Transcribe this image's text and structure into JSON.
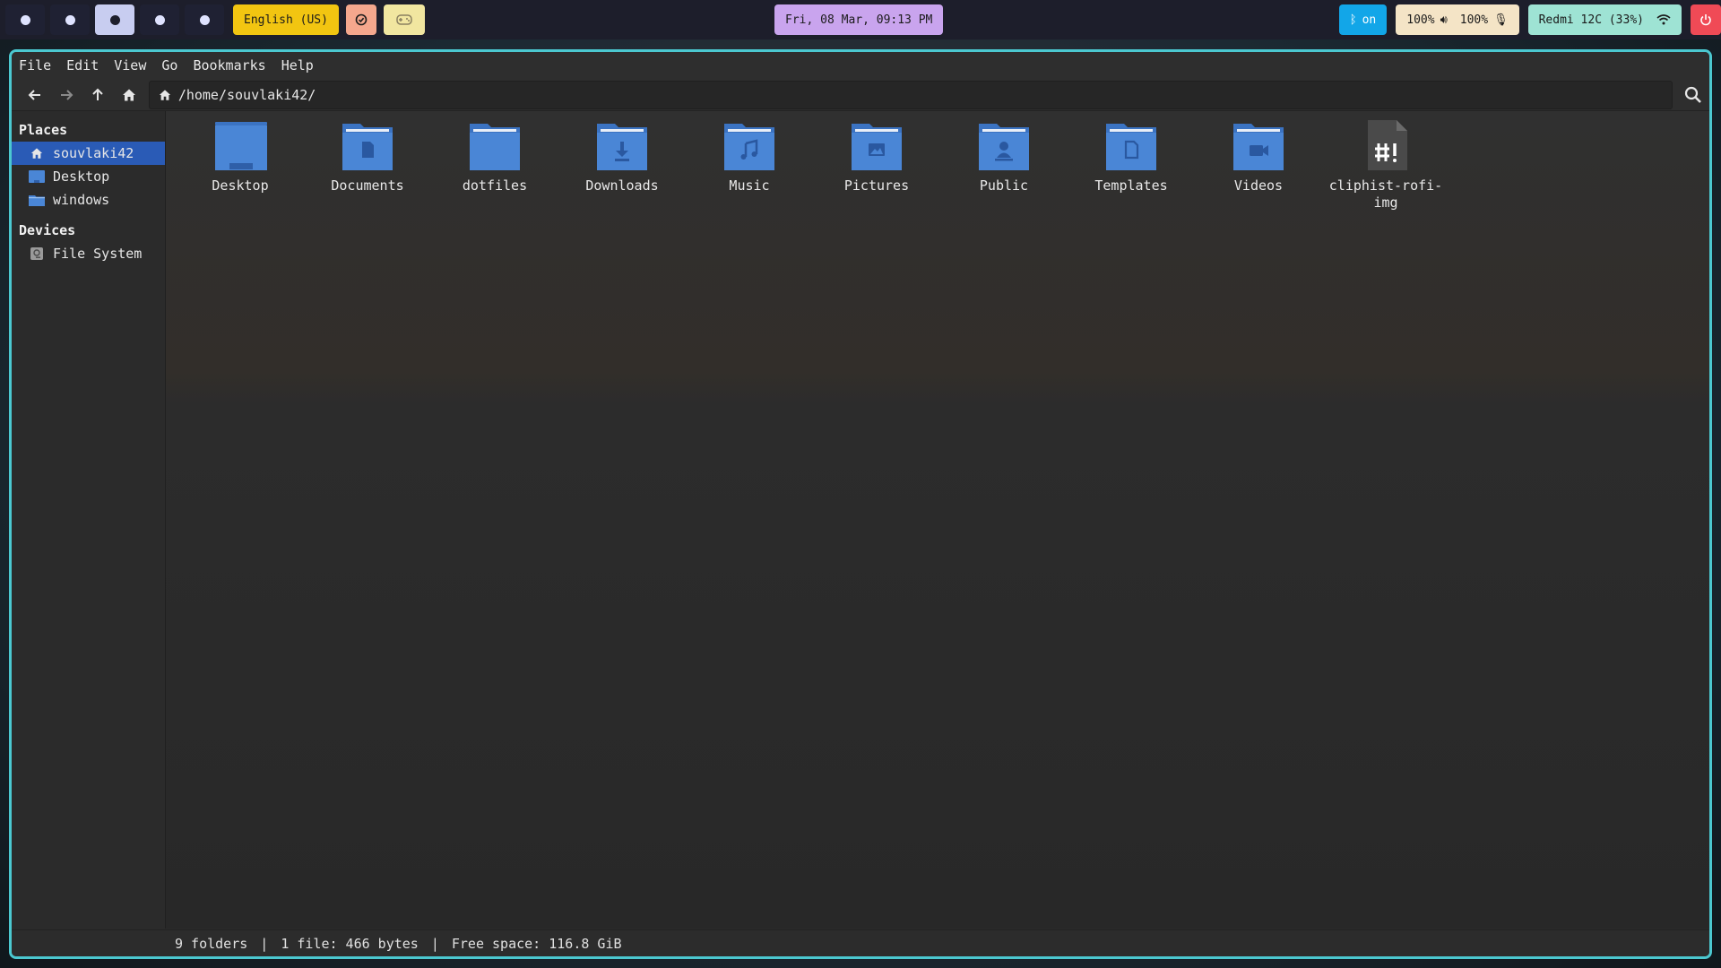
{
  "topbar": {
    "workspaces": [
      "",
      "",
      "",
      "",
      ""
    ],
    "keyboard_layout": "English (US)",
    "clock": "Fri, 08 Mar, 09:13 PM",
    "bluetooth": "on",
    "volume": "100%",
    "mic": "100%",
    "network": "Redmi 12C (33%)"
  },
  "menu": {
    "file": "File",
    "edit": "Edit",
    "view": "View",
    "go": "Go",
    "bookmarks": "Bookmarks",
    "help": "Help"
  },
  "path": "/home/souvlaki42/",
  "sidebar": {
    "places_label": "Places",
    "places": [
      {
        "label": "souvlaki42",
        "icon": "home-icon"
      },
      {
        "label": "Desktop",
        "icon": "desktop-icon"
      },
      {
        "label": "windows",
        "icon": "folder-icon"
      }
    ],
    "devices_label": "Devices",
    "devices": [
      {
        "label": "File System",
        "icon": "drive-icon"
      }
    ]
  },
  "files": [
    {
      "name": "Desktop",
      "icon": "desktop-folder-icon"
    },
    {
      "name": "Documents",
      "icon": "documents-folder-icon"
    },
    {
      "name": "dotfiles",
      "icon": "folder-icon"
    },
    {
      "name": "Downloads",
      "icon": "downloads-folder-icon"
    },
    {
      "name": "Music",
      "icon": "music-folder-icon"
    },
    {
      "name": "Pictures",
      "icon": "pictures-folder-icon"
    },
    {
      "name": "Public",
      "icon": "public-folder-icon"
    },
    {
      "name": "Templates",
      "icon": "templates-folder-icon"
    },
    {
      "name": "Videos",
      "icon": "videos-folder-icon"
    },
    {
      "name": "cliphist-rofi-img",
      "icon": "script-file-icon"
    }
  ],
  "status": {
    "folders": "9 folders",
    "files": "1 file: 466 bytes",
    "free": "Free space: 116.8 GiB"
  },
  "colors": {
    "accent_border": "#4bc8d0",
    "folder_blue": "#4a86d6",
    "selection": "#2a5bb6"
  }
}
